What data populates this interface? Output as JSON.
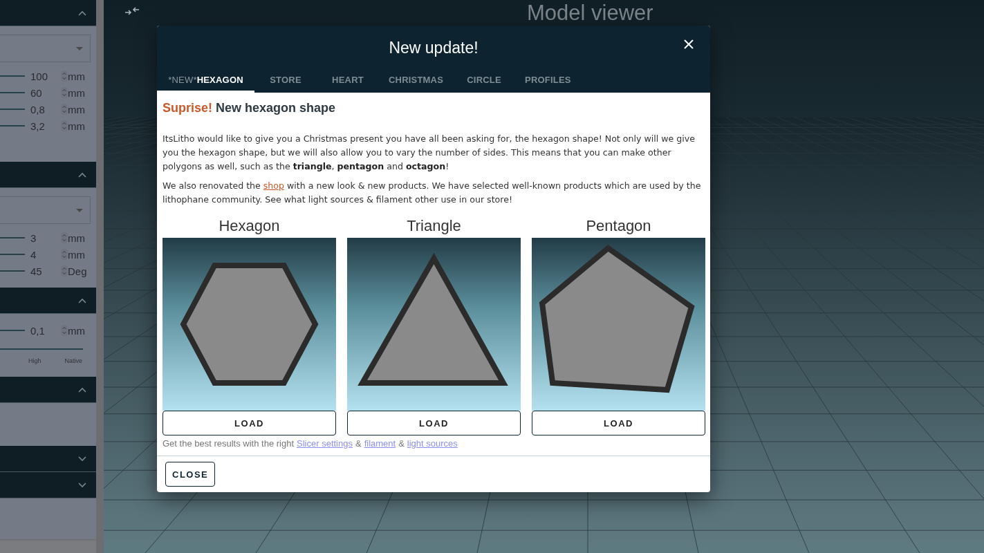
{
  "sidebar": {
    "sections": [
      {
        "expanded": true,
        "kind": "select",
        "rows": [
          {
            "value": "100",
            "unit": "mm"
          },
          {
            "value": "60",
            "unit": "mm"
          },
          {
            "value": "0,8",
            "unit": "mm"
          },
          {
            "value": "3,2",
            "unit": "mm"
          }
        ]
      },
      {
        "expanded": true,
        "kind": "select",
        "rows": [
          {
            "value": "3",
            "unit": "mm"
          },
          {
            "value": "4",
            "unit": "mm"
          },
          {
            "value": "45",
            "unit": "Deg"
          }
        ]
      },
      {
        "expanded": true,
        "kind": "quality",
        "rows": [
          {
            "value": "0,1",
            "unit": "mm"
          }
        ],
        "scale_labels": [
          "High",
          "Native"
        ]
      },
      {
        "expanded": true,
        "kind": "blank"
      },
      {
        "expanded": false
      },
      {
        "expanded": false
      }
    ]
  },
  "viewer": {
    "title": "Model viewer"
  },
  "dialog": {
    "title": "New update!",
    "tabs": [
      {
        "badge": "*NEW*",
        "label": "HEXAGON",
        "selected": true
      },
      {
        "label": "STORE",
        "selected": false
      },
      {
        "label": "HEART",
        "selected": false
      },
      {
        "label": "CHRISTMAS",
        "selected": false
      },
      {
        "label": "CIRCLE",
        "selected": false
      },
      {
        "label": "PROFILES",
        "selected": false
      }
    ],
    "heading": {
      "highlight": "Suprise!",
      "text": "New hexagon shape"
    },
    "paragraph_1": "ItsLitho would like to give you a Christmas present you have all been asking for, the hexagon shape! Not only will we give you the hexagon shape, but we will also allow you to vary the number of sides. This means that you can make other polygons as well, such as the **triangle**, **pentagon** and **octagon**!",
    "paragraph_2": {
      "before": "We also renovated the",
      "link": "shop",
      "after": "with a new look & new products. We have selected well-known products which are used by the lithophane community. See what light sources & filament other use in our store!"
    },
    "cards": [
      {
        "title": "Hexagon",
        "kind": "hexagon",
        "button": "LOAD"
      },
      {
        "title": "Triangle",
        "kind": "triangle",
        "button": "LOAD"
      },
      {
        "title": "Pentagon",
        "kind": "pentagon",
        "button": "LOAD"
      }
    ],
    "note": {
      "text": "Get the best results with the right",
      "links": [
        "Slicer settings",
        "filament",
        "light sources"
      ],
      "separator": "&"
    },
    "close_button": "CLOSE"
  }
}
